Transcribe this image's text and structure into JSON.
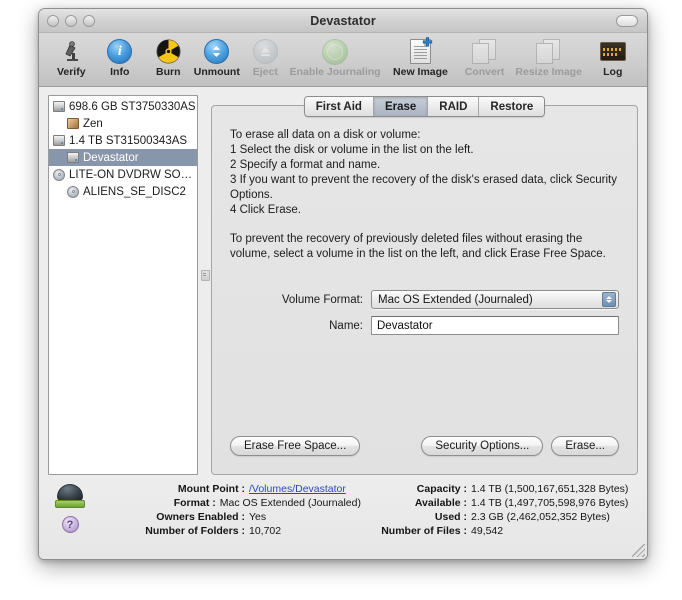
{
  "window": {
    "title": "Devastator",
    "traffic_lights": [
      "close-button",
      "minimize-button",
      "zoom-button"
    ],
    "toolbar_toggle": "toolbar-toggle-button"
  },
  "toolbar": {
    "items": [
      {
        "label": "Verify",
        "icon": "microscope-icon",
        "enabled": true
      },
      {
        "label": "Info",
        "icon": "info-icon",
        "enabled": true
      },
      {
        "label": "Burn",
        "icon": "burn-radiation-icon",
        "enabled": true
      },
      {
        "label": "Unmount",
        "icon": "unmount-icon",
        "enabled": true
      },
      {
        "label": "Eject",
        "icon": "eject-icon",
        "enabled": false
      },
      {
        "label": "Enable Journaling",
        "icon": "journaling-globe-icon",
        "enabled": false
      },
      {
        "label": "New Image",
        "icon": "new-image-icon",
        "enabled": true
      },
      {
        "label": "Convert",
        "icon": "convert-icon",
        "enabled": false
      },
      {
        "label": "Resize Image",
        "icon": "resize-image-icon",
        "enabled": false
      }
    ],
    "log": {
      "label": "Log",
      "icon": "log-icon"
    }
  },
  "sidebar": {
    "items": [
      {
        "label": "698.6 GB ST3750330AS",
        "icon": "hard-disk-icon",
        "indent": false,
        "selected": false
      },
      {
        "label": "Zen",
        "icon": "volume-icon",
        "indent": true,
        "selected": false
      },
      {
        "label": "1.4 TB ST31500343AS",
        "icon": "hard-disk-icon",
        "indent": false,
        "selected": false
      },
      {
        "label": "Devastator",
        "icon": "hard-disk-icon",
        "indent": true,
        "selected": true
      },
      {
        "label": "LITE-ON DVDRW SOHW-...",
        "icon": "optical-drive-icon",
        "indent": false,
        "selected": false
      },
      {
        "label": "ALIENS_SE_DISC2",
        "icon": "optical-disc-icon",
        "indent": true,
        "selected": false
      }
    ]
  },
  "tabs": [
    {
      "label": "First Aid",
      "active": false
    },
    {
      "label": "Erase",
      "active": true
    },
    {
      "label": "RAID",
      "active": false
    },
    {
      "label": "Restore",
      "active": false
    }
  ],
  "erase_panel": {
    "intro": "To erase all data on a disk or volume:",
    "steps": [
      "1  Select the disk or volume in the list on the left.",
      "2  Specify a format and name.",
      "3  If you want to prevent the recovery of the disk's erased data, click Security Options.",
      "4  Click Erase."
    ],
    "note": "To prevent the recovery of previously deleted files without erasing the volume, select a volume in the list on the left, and click Erase Free Space.",
    "volume_format_label": "Volume Format:",
    "volume_format_value": "Mac OS Extended (Journaled)",
    "name_label": "Name:",
    "name_value": "Devastator",
    "erase_free_space_button": "Erase Free Space...",
    "security_options_button": "Security Options...",
    "erase_button": "Erase..."
  },
  "info": {
    "left": [
      {
        "key": "Mount Point",
        "value": "/Volumes/Devastator",
        "link": true
      },
      {
        "key": "Format",
        "value": "Mac OS Extended (Journaled)",
        "link": false
      },
      {
        "key": "Owners Enabled",
        "value": "Yes",
        "link": false
      },
      {
        "key": "Number of Folders",
        "value": "10,702",
        "link": false
      }
    ],
    "right": [
      {
        "key": "Capacity",
        "value": "1.4 TB (1,500,167,651,328 Bytes)"
      },
      {
        "key": "Available",
        "value": "1.4 TB (1,497,705,598,976 Bytes)"
      },
      {
        "key": "Used",
        "value": "2.3 GB (2,462,052,352 Bytes)"
      },
      {
        "key": "Number of Files",
        "value": "49,542"
      }
    ],
    "volume_icon": "volume-badge-icon",
    "help_label": "?"
  }
}
